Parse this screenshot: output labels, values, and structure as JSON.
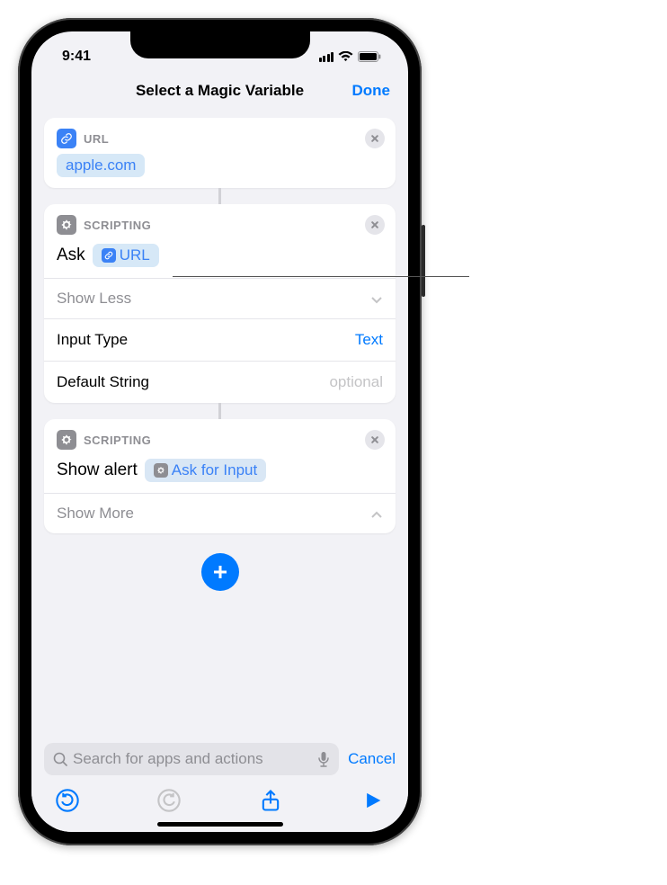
{
  "status": {
    "time": "9:41"
  },
  "nav": {
    "title": "Select a Magic Variable",
    "done": "Done"
  },
  "card1": {
    "label": "URL",
    "chip_text": "apple.com"
  },
  "card2": {
    "label": "SCRIPTING",
    "ask_text": "Ask",
    "chip_text": "URL",
    "show_less": "Show Less",
    "input_type_label": "Input Type",
    "input_type_value": "Text",
    "default_string_label": "Default String",
    "default_string_placeholder": "optional"
  },
  "card3": {
    "label": "SCRIPTING",
    "show_alert_text": "Show alert",
    "chip_text": "Ask for Input",
    "show_more": "Show More"
  },
  "search": {
    "placeholder": "Search for apps and actions",
    "cancel": "Cancel"
  }
}
